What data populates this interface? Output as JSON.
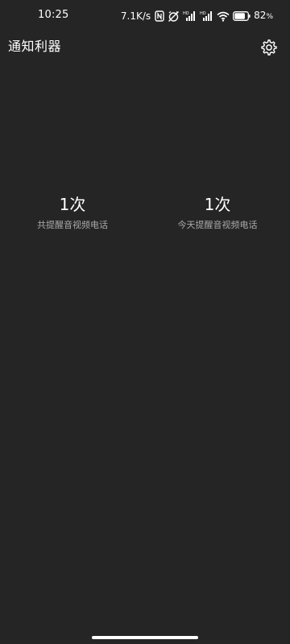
{
  "status_bar": {
    "time": "10:25",
    "net_speed": "7.1K/s",
    "battery_percent": "82",
    "battery_percent_sign": "%",
    "battery_level": 0.82,
    "icons": [
      "nfc-icon",
      "alarm-off-icon",
      "signal-hd-icon",
      "signal-hd-icon",
      "wifi-icon",
      "battery-icon"
    ]
  },
  "app_bar": {
    "title": "通知利器",
    "settings_icon": "gear-icon"
  },
  "stats": [
    {
      "count": "1次",
      "label": "共提醒音视频电话"
    },
    {
      "count": "1次",
      "label": "今天提醒音视频电话"
    }
  ],
  "colors": {
    "background": "#252525",
    "text_primary": "#ffffff",
    "text_secondary": "#aaaaaa"
  }
}
